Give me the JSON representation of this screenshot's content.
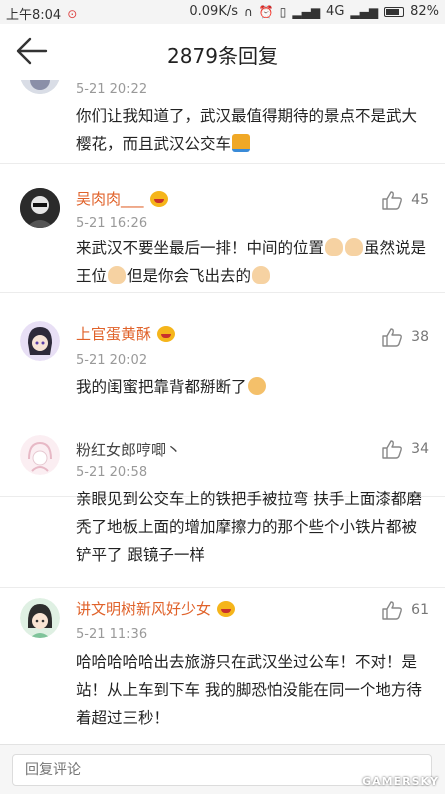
{
  "status_bar": {
    "time": "上午8:04",
    "network_speed": "0.09K/s",
    "signal": "4G",
    "battery": "82%",
    "battery_level": 0.82
  },
  "header": {
    "title": "2879条回复"
  },
  "comments": [
    {
      "name": "",
      "time": "5-21 20:22",
      "text": "你们让我知道了，武汉最值得期待的景点不是武大樱花，而且武汉公交车",
      "likes": ""
    },
    {
      "name": "吴肉肉___",
      "time": "5-21 16:26",
      "text_a": "来武汉不要坐最后一排！中间的位置",
      "text_b": "虽然说是王位",
      "text_c": "但是你会飞出去的",
      "likes": "45"
    },
    {
      "name": "上官蛋黄酥",
      "time": "5-21 20:02",
      "text": "我的闺蜜把靠背都掰断了",
      "likes": "38"
    },
    {
      "name": "粉红女郎哼唧丶",
      "time": "5-21 20:58",
      "text": "亲眼见到公交车上的铁把手被拉弯  扶手上面漆都磨秃了地板上面的增加摩擦力的那个些个小铁片都被铲平了  跟镜子一样",
      "likes": "34"
    },
    {
      "name": "讲文明树新风好少女",
      "time": "5-21 11:36",
      "text": "哈哈哈哈哈出去旅游只在武汉坐过公车！不对！是站！从上车到下车 我的脚恐怕没能在同一个地方待着超过三秒！",
      "likes": "61"
    }
  ],
  "footer": {
    "reply_placeholder": "回复评论",
    "watermark": "GAMERSKY"
  },
  "icons": {
    "back": "back-arrow-icon",
    "like": "thumbs-up-icon",
    "vip": "vip-badge-icon"
  }
}
